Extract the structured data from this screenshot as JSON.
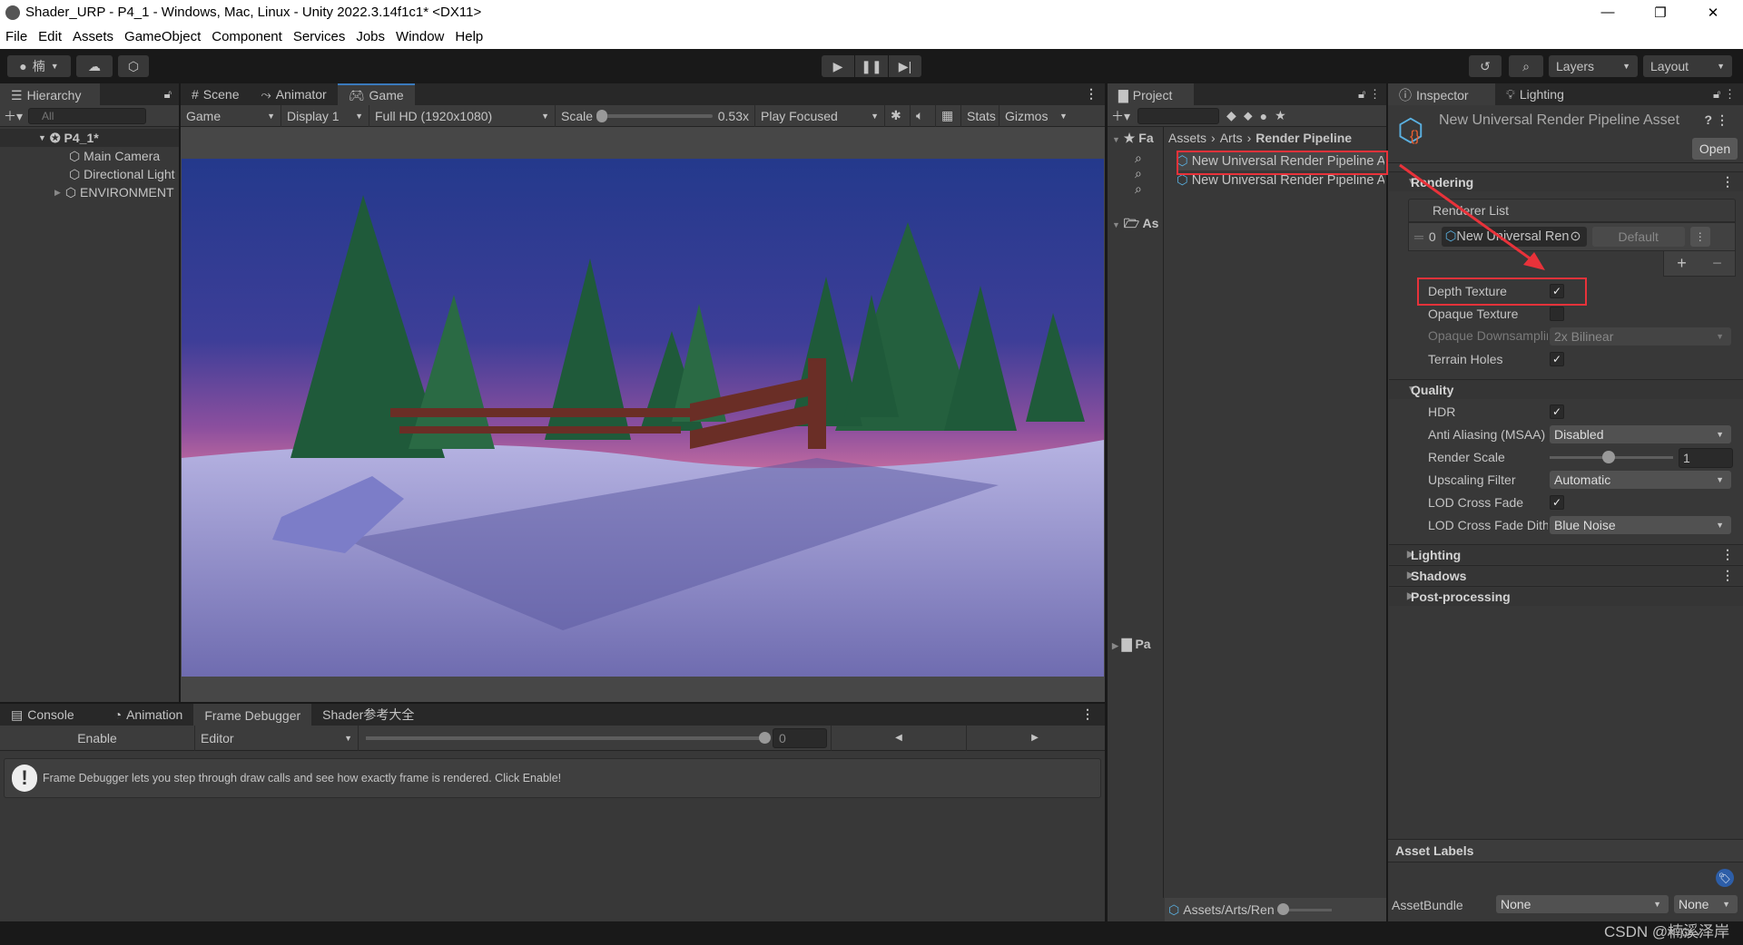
{
  "window": {
    "title": "Shader_URP - P4_1 - Windows, Mac, Linux - Unity 2022.3.14f1c1* <DX11>",
    "controls": [
      "—",
      "❐",
      "✕"
    ]
  },
  "menu": [
    "File",
    "Edit",
    "Assets",
    "GameObject",
    "Component",
    "Services",
    "Jobs",
    "Window",
    "Help"
  ],
  "toolbar": {
    "account": "楠",
    "layers": "Layers",
    "layout": "Layout"
  },
  "hierarchy": {
    "tab": "Hierarchy",
    "search_placeholder": "All",
    "scene": "P4_1*",
    "items": [
      "Main Camera",
      "Directional Light",
      "ENVIRONMENT"
    ]
  },
  "center": {
    "tabs": [
      "Scene",
      "Animator",
      "Game"
    ],
    "active_tab": "Game",
    "game_mode": "Game",
    "display": "Display 1",
    "resolution": "Full HD (1920x1080)",
    "scale_label": "Scale",
    "scale_value": "0.53x",
    "scale_fraction": 0.0,
    "play_mode": "Play Focused",
    "stats": "Stats",
    "gizmos": "Gizmos"
  },
  "bottom": {
    "tabs": [
      "Console",
      "Animation",
      "Frame Debugger",
      "Shader参考大全"
    ],
    "active_tab": "Frame Debugger",
    "enable": "Enable",
    "target": "Editor",
    "frame_value": "0",
    "message": "Frame Debugger lets you step through draw calls and see how exactly frame is rendered. Click Enable!"
  },
  "project": {
    "tab": "Project",
    "favorites": "Fa",
    "assets_root": "As",
    "packages": "Pa",
    "breadcrumb": [
      "Assets",
      "Arts",
      "Render Pipeline"
    ],
    "items": [
      "New Universal Render Pipeline Asset",
      "New Universal Render Pipeline Asset_Renderer"
    ],
    "path": "Assets/Arts/Render Pipeline"
  },
  "inspector": {
    "tabs": [
      "Inspector",
      "Lighting"
    ],
    "asset_title": "New Universal Render Pipeline Asset",
    "open": "Open",
    "rendering": {
      "title": "Rendering",
      "renderer_list": "Renderer List",
      "renderer_index": "0",
      "renderer_name": "New Universal Render Pipeline Asset_Renderer",
      "default": "Default",
      "depth_texture": {
        "label": "Depth Texture",
        "checked": true
      },
      "opaque_texture": {
        "label": "Opaque Texture",
        "checked": false
      },
      "opaque_downsampling": {
        "label": "Opaque Downsampling",
        "value": "2x Bilinear"
      },
      "terrain_holes": {
        "label": "Terrain Holes",
        "checked": true
      }
    },
    "quality": {
      "title": "Quality",
      "hdr": {
        "label": "HDR",
        "checked": true
      },
      "anti_aliasing": {
        "label": "Anti Aliasing (MSAA)",
        "value": "Disabled"
      },
      "render_scale": {
        "label": "Render Scale",
        "value": "1"
      },
      "upscaling": {
        "label": "Upscaling Filter",
        "value": "Automatic"
      },
      "lod_cross_fade": {
        "label": "LOD Cross Fade",
        "checked": true
      },
      "lod_dither": {
        "label": "LOD Cross Fade Dithering Type",
        "value": "Blue Noise"
      }
    },
    "collapsed_sections": [
      "Lighting",
      "Shadows",
      "Post-processing"
    ],
    "asset_labels": "Asset Labels",
    "asset_bundle": "AssetBundle",
    "bundle_value": "None",
    "bundle_variant": "None"
  },
  "watermark": "CSDN @楠溪泽岸",
  "colors": {
    "highlight": "#e8323a",
    "accent": "#3a79bb"
  }
}
